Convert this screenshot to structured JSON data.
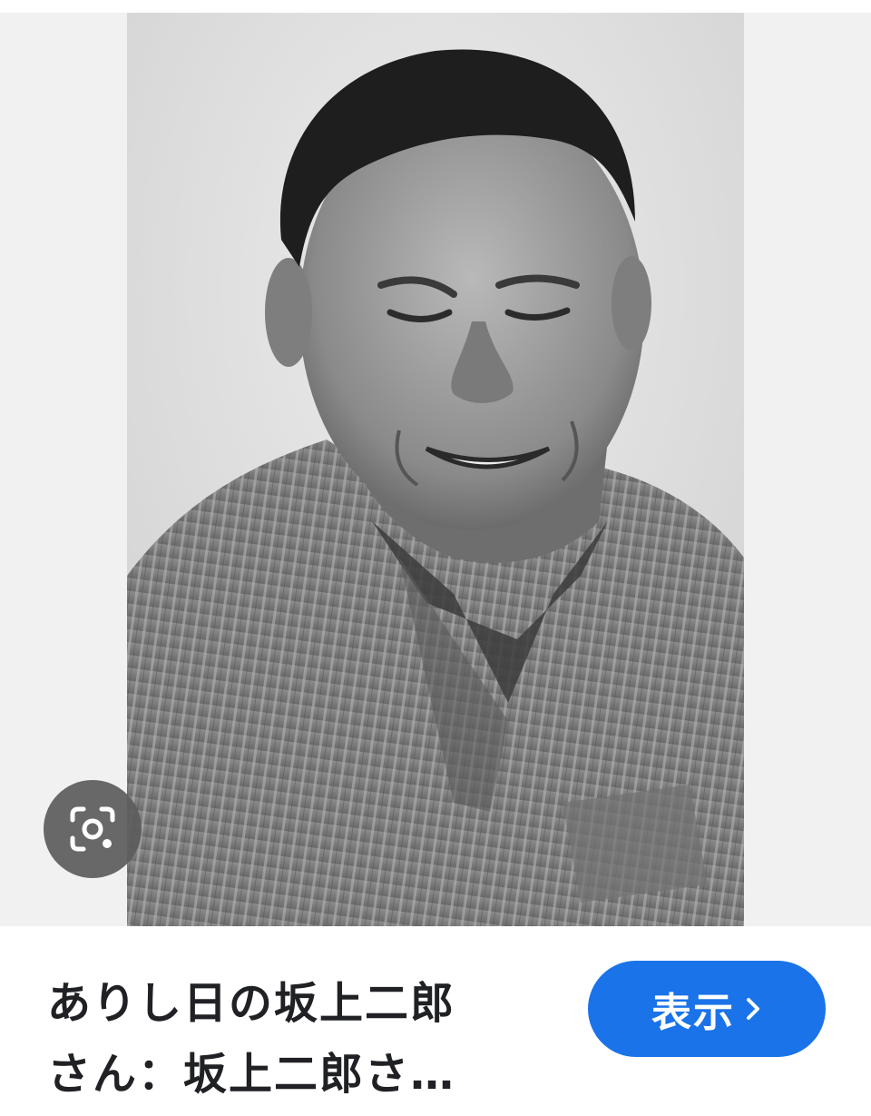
{
  "image_viewer": {
    "image_subject": "portrait-photo",
    "lens_icon": "google-lens-icon"
  },
  "result": {
    "title_line1": "ありし日の坂上二郎",
    "title_line2": "さん：坂上二郎さ…"
  },
  "actions": {
    "show_label": "表示",
    "show_icon": "chevron-right-icon",
    "accent_color": "#1a73e8"
  }
}
